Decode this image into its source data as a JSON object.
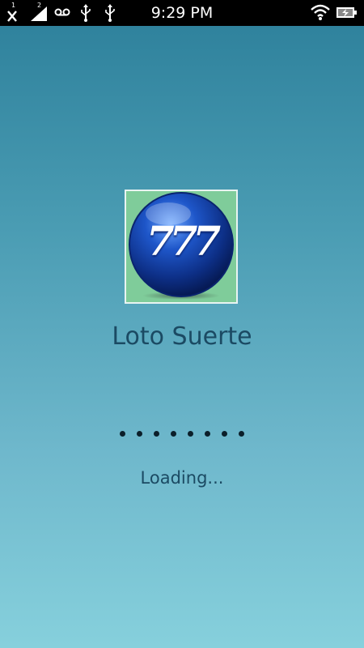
{
  "status_bar": {
    "time": "9:29 PM",
    "sim1_label": "1",
    "sim2_label": "2",
    "icons": [
      "no-signal-icon",
      "signal-bars-icon",
      "voicemail-icon",
      "usb-icon",
      "usb-icon",
      "wifi-icon",
      "battery-charging-icon"
    ]
  },
  "splash": {
    "logo_text": "777",
    "app_name": "Loto Suerte",
    "loading_text": "Loading...",
    "dot_count": 8
  },
  "colors": {
    "background_top": "#2c7f9a",
    "background_bottom": "#86d0dc",
    "logo_bg": "#7fcc9a",
    "ball_blue": "#1a3fa0",
    "title_text": "#1b4a63"
  }
}
